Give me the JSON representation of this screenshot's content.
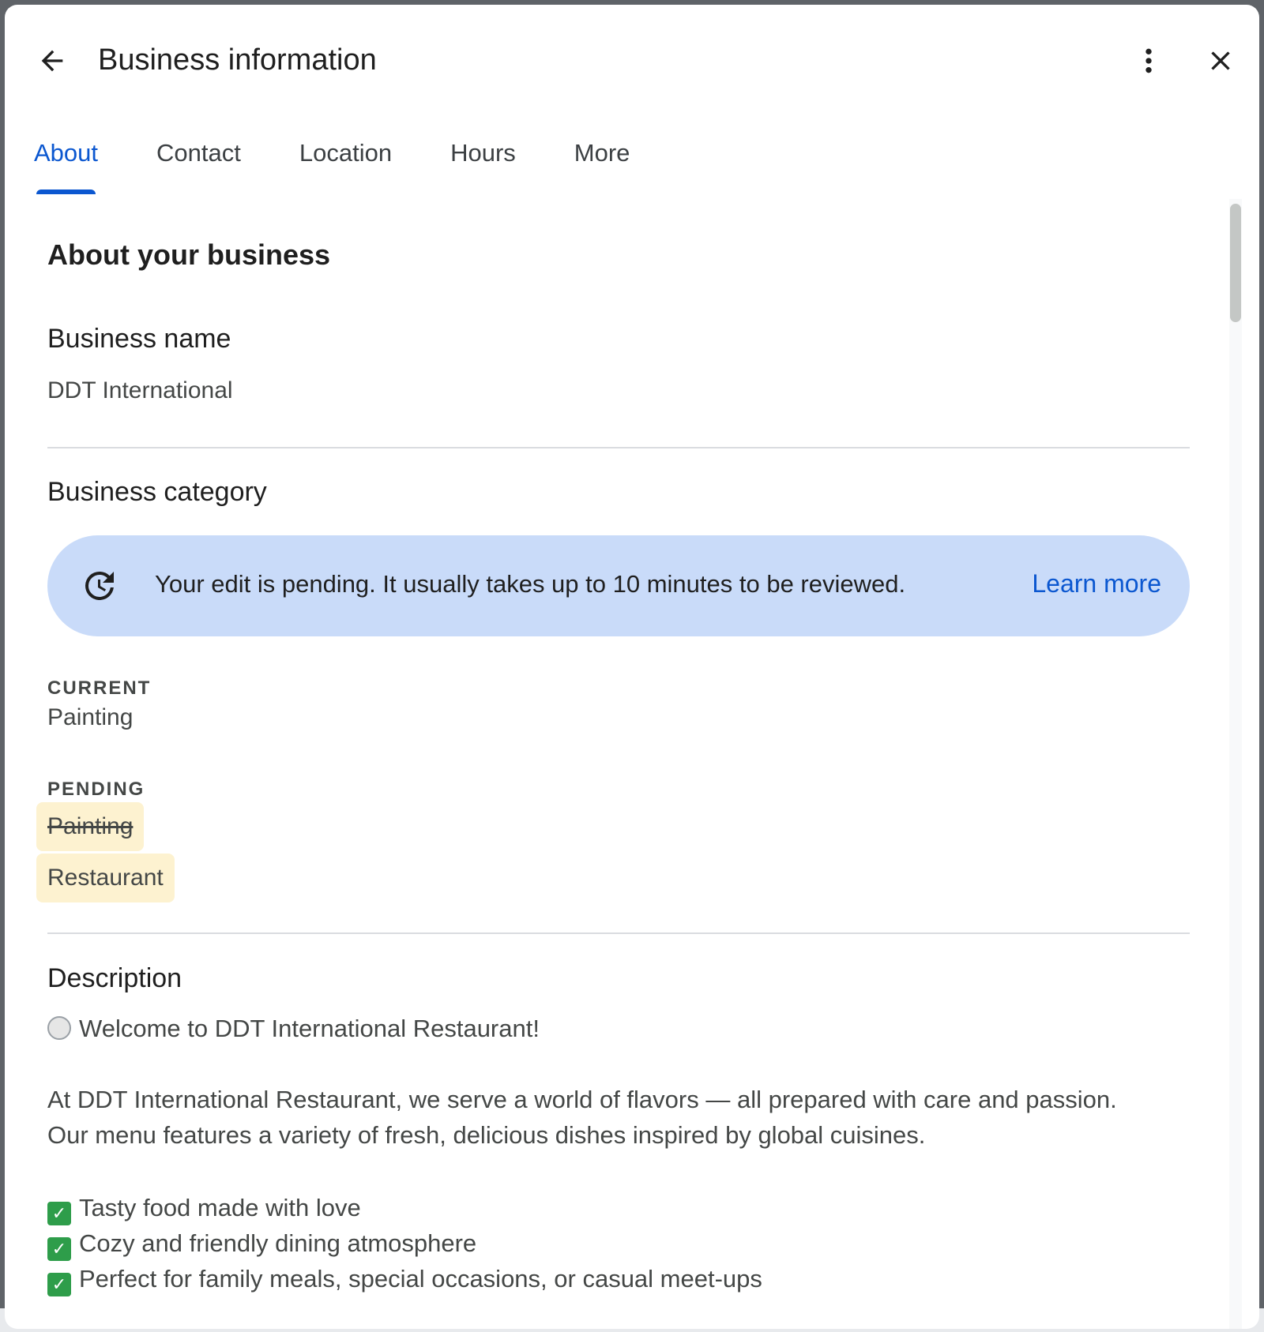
{
  "header": {
    "title": "Business information",
    "back_icon": "arrow-back-icon",
    "more_icon": "more-vert-icon",
    "close_icon": "close-icon"
  },
  "tabs": [
    {
      "label": "About",
      "active": true
    },
    {
      "label": "Contact",
      "active": false
    },
    {
      "label": "Location",
      "active": false
    },
    {
      "label": "Hours",
      "active": false
    },
    {
      "label": "More",
      "active": false
    }
  ],
  "about": {
    "heading": "About your business",
    "business_name": {
      "label": "Business name",
      "value": "DDT International"
    },
    "business_category": {
      "label": "Business category",
      "pending_banner": {
        "icon": "pending-history-icon",
        "text": "Your edit is pending. It usually takes up to 10 minutes to be reviewed.",
        "link": "Learn more"
      },
      "current_caption": "CURRENT",
      "current_value": "Painting",
      "pending_caption": "PENDING",
      "pending_removed": "Painting",
      "pending_added": "Restaurant"
    },
    "description": {
      "label": "Description",
      "welcome": "Welcome to DDT International Restaurant!",
      "para1": "At DDT International Restaurant, we serve a world of flavors — all prepared with care and passion.",
      "para2": "Our menu features a variety of fresh, delicious dishes inspired by global cuisines.",
      "bullets": [
        "Tasty food made with love",
        "Cozy and friendly dining atmosphere",
        "Perfect for family meals, special occasions, or casual meet-ups"
      ]
    }
  },
  "colors": {
    "accent": "#0b57d0",
    "banner_bg": "#c9dbf9",
    "chip_bg": "#fdf2d0"
  }
}
